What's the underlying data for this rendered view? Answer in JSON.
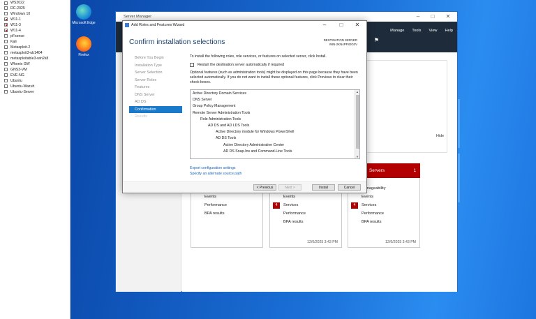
{
  "vm_list": [
    "WS2022",
    "DC-2025",
    "Windows 10",
    "W11-1",
    "W11-3",
    "W11-4",
    "pFsense",
    "Kali",
    "Metasploit-2",
    "metasploit3-ub1404",
    "metasploitable3-win2k8",
    "Whonix GW",
    "GNS3-VM",
    "EVE-NG",
    "Ubuntu",
    "Ubuntu-Wazuh",
    "Ubuntu-Server"
  ],
  "desktop": {
    "edge_label": "Microsoft Edge",
    "firefox_label": "Firefox"
  },
  "server_manager": {
    "title": "Server Manager",
    "menu": {
      "manage": "Manage",
      "tools": "Tools",
      "view": "View",
      "help": "Help"
    },
    "hide_label": "Hide",
    "tiles": [
      {
        "rows": [
          "Events",
          "Performance",
          "BPA results"
        ]
      },
      {
        "rows": [
          "Events",
          "Services",
          "Performance",
          "BPA results"
        ],
        "badge": "4",
        "time": "12/6/2025 3:43 PM"
      },
      {
        "header": "Servers",
        "count": "1",
        "rows": [
          "Manageability",
          "Events",
          "Services",
          "Performance",
          "BPA results"
        ],
        "badge": "4",
        "time": "12/6/2025 3:43 PM"
      }
    ]
  },
  "wizard": {
    "title": "Add Roles and Features Wizard",
    "heading": "Confirm installation selections",
    "dest_label": "DESTINATION SERVER",
    "dest_server": "WIN-2KN4PF82G0V",
    "steps": [
      "Before You Begin",
      "Installation Type",
      "Server Selection",
      "Server Roles",
      "Features",
      "DNS Server",
      "AD DS",
      "Confirmation",
      "Results"
    ],
    "active_step": 7,
    "intro": "To install the following roles, role services, or features on selected server, click Install.",
    "restart_label": "Restart the destination server automatically if required",
    "optional_text": "Optional features (such as administration tools) might be displayed on this page because they have been selected automatically. If you do not want to install these optional features, click Previous to clear their check boxes.",
    "features": [
      {
        "text": "Active Directory Domain Services",
        "level": 0
      },
      {
        "text": "DNS Server",
        "level": 0
      },
      {
        "text": "Group Policy Management",
        "level": 0
      },
      {
        "text": "Remote Server Administration Tools",
        "level": 0
      },
      {
        "text": "Role Administration Tools",
        "level": 1
      },
      {
        "text": "AD DS and AD LDS Tools",
        "level": 2
      },
      {
        "text": "Active Directory module for Windows PowerShell",
        "level": 3
      },
      {
        "text": "AD DS Tools",
        "level": 3
      },
      {
        "text": "Active Directory Administrative Center",
        "level": 4
      },
      {
        "text": "AD DS Snap-Ins and Command-Line Tools",
        "level": 4
      }
    ],
    "export_link": "Export configuration settings",
    "alt_source_link": "Specify an alternate source path",
    "buttons": {
      "previous": "< Previous",
      "next": "Next >",
      "install": "Install",
      "cancel": "Cancel"
    }
  }
}
